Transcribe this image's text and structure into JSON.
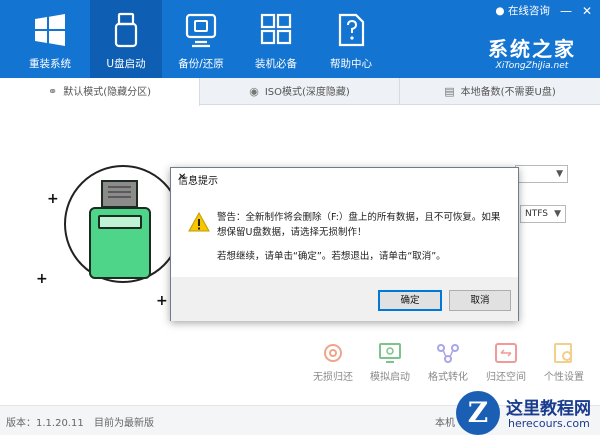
{
  "header": {
    "nav": [
      {
        "label": "重装系统",
        "icon": "windows-logo-icon"
      },
      {
        "label": "U盘启动",
        "icon": "usb-drive-icon"
      },
      {
        "label": "备份/还原",
        "icon": "backup-restore-icon"
      },
      {
        "label": "装机必备",
        "icon": "apps-grid-icon"
      },
      {
        "label": "帮助中心",
        "icon": "help-document-icon"
      }
    ],
    "online_help": "在线咨询",
    "brand_main": "系统之家",
    "brand_sub": "XiTongZhiJia.net"
  },
  "tabs": [
    {
      "label": "默认模式(隐藏分区)",
      "icon": "usb-symbol-icon"
    },
    {
      "label": "ISO模式(深度隐藏)",
      "icon": "disc-icon"
    },
    {
      "label": "本地备数(不需要U盘)",
      "icon": "hard-drive-icon"
    }
  ],
  "main": {
    "format_value": "NTFS",
    "tools": [
      {
        "label": "无损归还",
        "icon": "restore-icon",
        "color": "#f0a48a"
      },
      {
        "label": "模拟启动",
        "icon": "monitor-power-icon",
        "color": "#7cc48c"
      },
      {
        "label": "格式转化",
        "icon": "convert-nodes-icon",
        "color": "#a6a6e8"
      },
      {
        "label": "归还空间",
        "icon": "space-return-icon",
        "color": "#f09a9a"
      },
      {
        "label": "个性设置",
        "icon": "personal-settings-icon",
        "color": "#f2cf8a"
      }
    ]
  },
  "status": {
    "version": "版本：1.1.20.11",
    "latest": "目前为最新版",
    "local_prefix": "本机"
  },
  "dialog": {
    "title": "信息提示",
    "message1": "警告：全新制作将会删除（F:）盘上的所有数据，且不可恢复。如果想保留U盘数据，请选择无损制作！",
    "message2": "若想继续，请单击“确定”。若想退出，请单击“取消”。",
    "ok_label": "确定",
    "cancel_label": "取消"
  },
  "watermark": {
    "title": "这里教程网",
    "url": "herecours.com"
  },
  "colors": {
    "header_bg": "#1474d1",
    "active_nav_bg": "#0e5fb3",
    "usb_green": "#4fd58a",
    "dialog_default_border": "#0078d7"
  }
}
